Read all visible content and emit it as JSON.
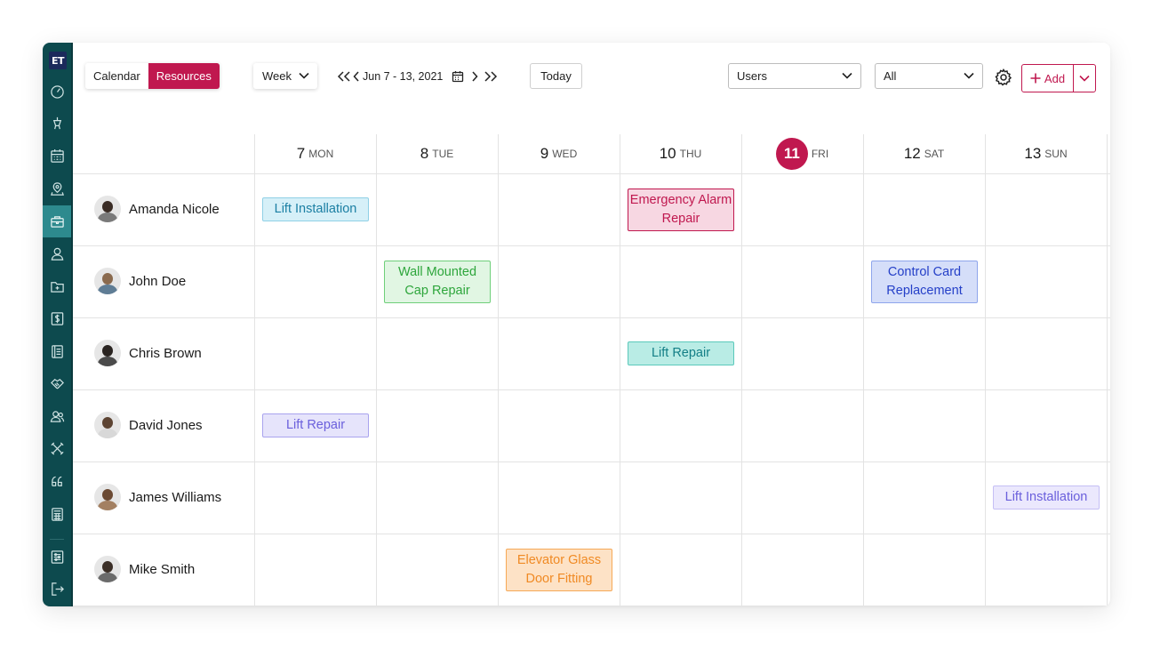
{
  "logo_text": "ET",
  "sidebar": {
    "items": [
      {
        "icon": "dashboard-icon"
      },
      {
        "icon": "elevator-icon"
      },
      {
        "icon": "calendar-grid-icon"
      },
      {
        "icon": "map-pin-icon"
      },
      {
        "icon": "briefcase-icon",
        "active": true
      },
      {
        "icon": "user-icon"
      },
      {
        "icon": "folder-add-icon"
      },
      {
        "icon": "dollar-icon"
      },
      {
        "icon": "document-icon"
      },
      {
        "icon": "handshake-icon"
      },
      {
        "icon": "users-icon"
      },
      {
        "icon": "tools-icon"
      },
      {
        "icon": "quote-icon"
      },
      {
        "icon": "calculator-icon"
      },
      {
        "icon": "sliders-icon"
      },
      {
        "icon": "logout-icon"
      }
    ]
  },
  "toolbar": {
    "view_calendar": "Calendar",
    "view_resources": "Resources",
    "range_select": "Week",
    "date_range": "Jun 7 - 13, 2021",
    "today_label": "Today",
    "users_select": "Users",
    "filter_select": "All",
    "add_label": "Add"
  },
  "days": [
    {
      "num": "7",
      "name": "MON"
    },
    {
      "num": "8",
      "name": "TUE"
    },
    {
      "num": "9",
      "name": "WED"
    },
    {
      "num": "10",
      "name": "THU"
    },
    {
      "num": "11",
      "name": "FRI",
      "today": true
    },
    {
      "num": "12",
      "name": "SAT"
    },
    {
      "num": "13",
      "name": "SUN"
    }
  ],
  "people": [
    {
      "name": "Amanda Nicole"
    },
    {
      "name": "John Doe"
    },
    {
      "name": "Chris Brown"
    },
    {
      "name": "David Jones"
    },
    {
      "name": "James Williams"
    },
    {
      "name": "Mike Smith"
    }
  ],
  "events": [
    {
      "title": "Lift Installation",
      "person": 0,
      "day": 0,
      "bg": "#d6f0f8",
      "border": "#8fd0e6",
      "color": "#1b7fa3"
    },
    {
      "title": "Emergency Alarm Repair",
      "person": 0,
      "day": 3,
      "bg": "#f7d7e2",
      "border": "#c0184f",
      "color": "#c0184f"
    },
    {
      "title": "Wall Mounted Cap Repair",
      "person": 1,
      "day": 1,
      "bg": "#e1f6e3",
      "border": "#6fcf7a",
      "color": "#2ea63c"
    },
    {
      "title": "Control Card Replacement",
      "person": 1,
      "day": 5,
      "bg": "#d5def9",
      "border": "#8ea5ec",
      "color": "#2540c8"
    },
    {
      "title": "Lift Repair",
      "person": 2,
      "day": 3,
      "bg": "#b9ece5",
      "border": "#5bc9bb",
      "color": "#137f86"
    },
    {
      "title": "Lift Repair",
      "person": 3,
      "day": 0,
      "bg": "#e6e4fb",
      "border": "#a9a3ee",
      "color": "#6a5fdc"
    },
    {
      "title": "Lift Installation",
      "person": 4,
      "day": 6,
      "bg": "#ebe8fd",
      "border": "#c5bff5",
      "color": "#6a5fdc"
    },
    {
      "title": "Elevator Glass Door Fitting",
      "person": 5,
      "day": 2,
      "bg": "#fde2c6",
      "border": "#f6a957",
      "color": "#f08a24"
    }
  ]
}
